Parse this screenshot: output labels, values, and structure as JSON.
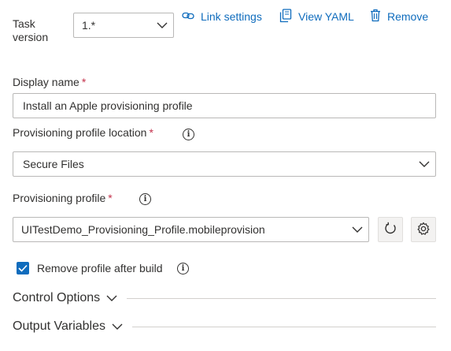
{
  "task_version": {
    "label": "Task version",
    "value": "1.*"
  },
  "toolbar": {
    "link_settings": "Link settings",
    "view_yaml": "View YAML",
    "remove": "Remove"
  },
  "display_name": {
    "label": "Display name",
    "required": "*",
    "value": "Install an Apple provisioning profile"
  },
  "profile_location": {
    "label": "Provisioning profile location",
    "required": "*",
    "value": "Secure Files"
  },
  "profile": {
    "label": "Provisioning profile",
    "required": "*",
    "value": "UITestDemo_Provisioning_Profile.mobileprovision"
  },
  "remove_after_build": {
    "label": "Remove profile after build",
    "checked": true
  },
  "sections": {
    "control_options": "Control Options",
    "output_variables": "Output Variables"
  },
  "colors": {
    "accent": "#0f6cbd",
    "required": "#c4314b",
    "text": "#323130",
    "border": "#b9b8b7"
  },
  "icons": [
    "link-icon",
    "copy-icon",
    "trash-icon",
    "chevron-down-icon",
    "info-icon",
    "refresh-icon",
    "gear-icon",
    "checkmark-icon"
  ]
}
